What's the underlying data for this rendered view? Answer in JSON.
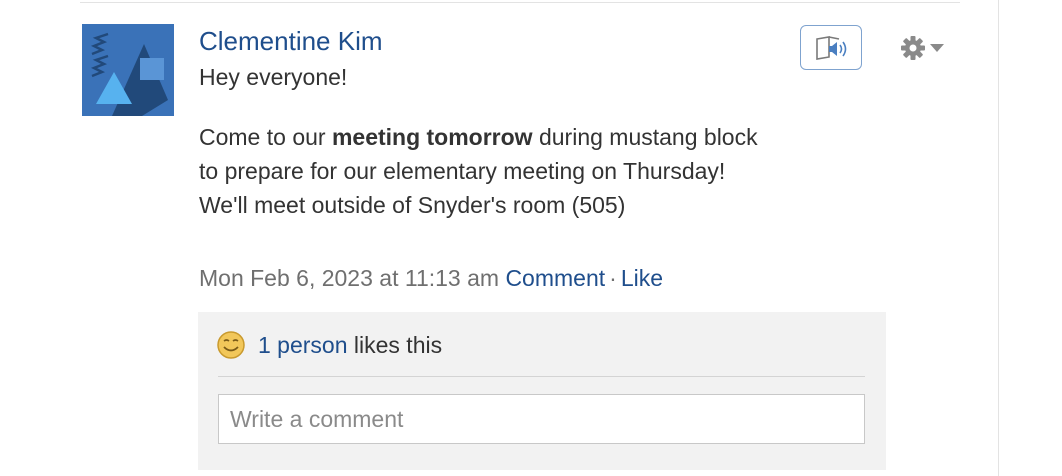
{
  "post": {
    "author": "Clementine Kim",
    "greeting": "Hey everyone!",
    "body_before_bold": "Come to our ",
    "body_bold": "meeting tomorrow",
    "body_after_bold": " during mustang block to prepare for our elementary meeting on Thursday! We'll meet outside of Snyder's room (505)",
    "timestamp": "Mon Feb 6, 2023 at 11:13 am",
    "comment_link": "Comment",
    "separator": "·",
    "like_link": "Like"
  },
  "likes": {
    "count_link": "1 person",
    "suffix": " likes this"
  },
  "comment_box": {
    "placeholder": "Write a comment"
  },
  "icons": {
    "read_aloud": "read-aloud-icon",
    "settings": "gear-icon",
    "dropdown": "caret-down-icon",
    "smiley": "smiley-icon"
  },
  "colors": {
    "link": "#1f4e8c",
    "avatar_bg": "#3a72b8",
    "likes_bg": "#f2f2f2"
  }
}
